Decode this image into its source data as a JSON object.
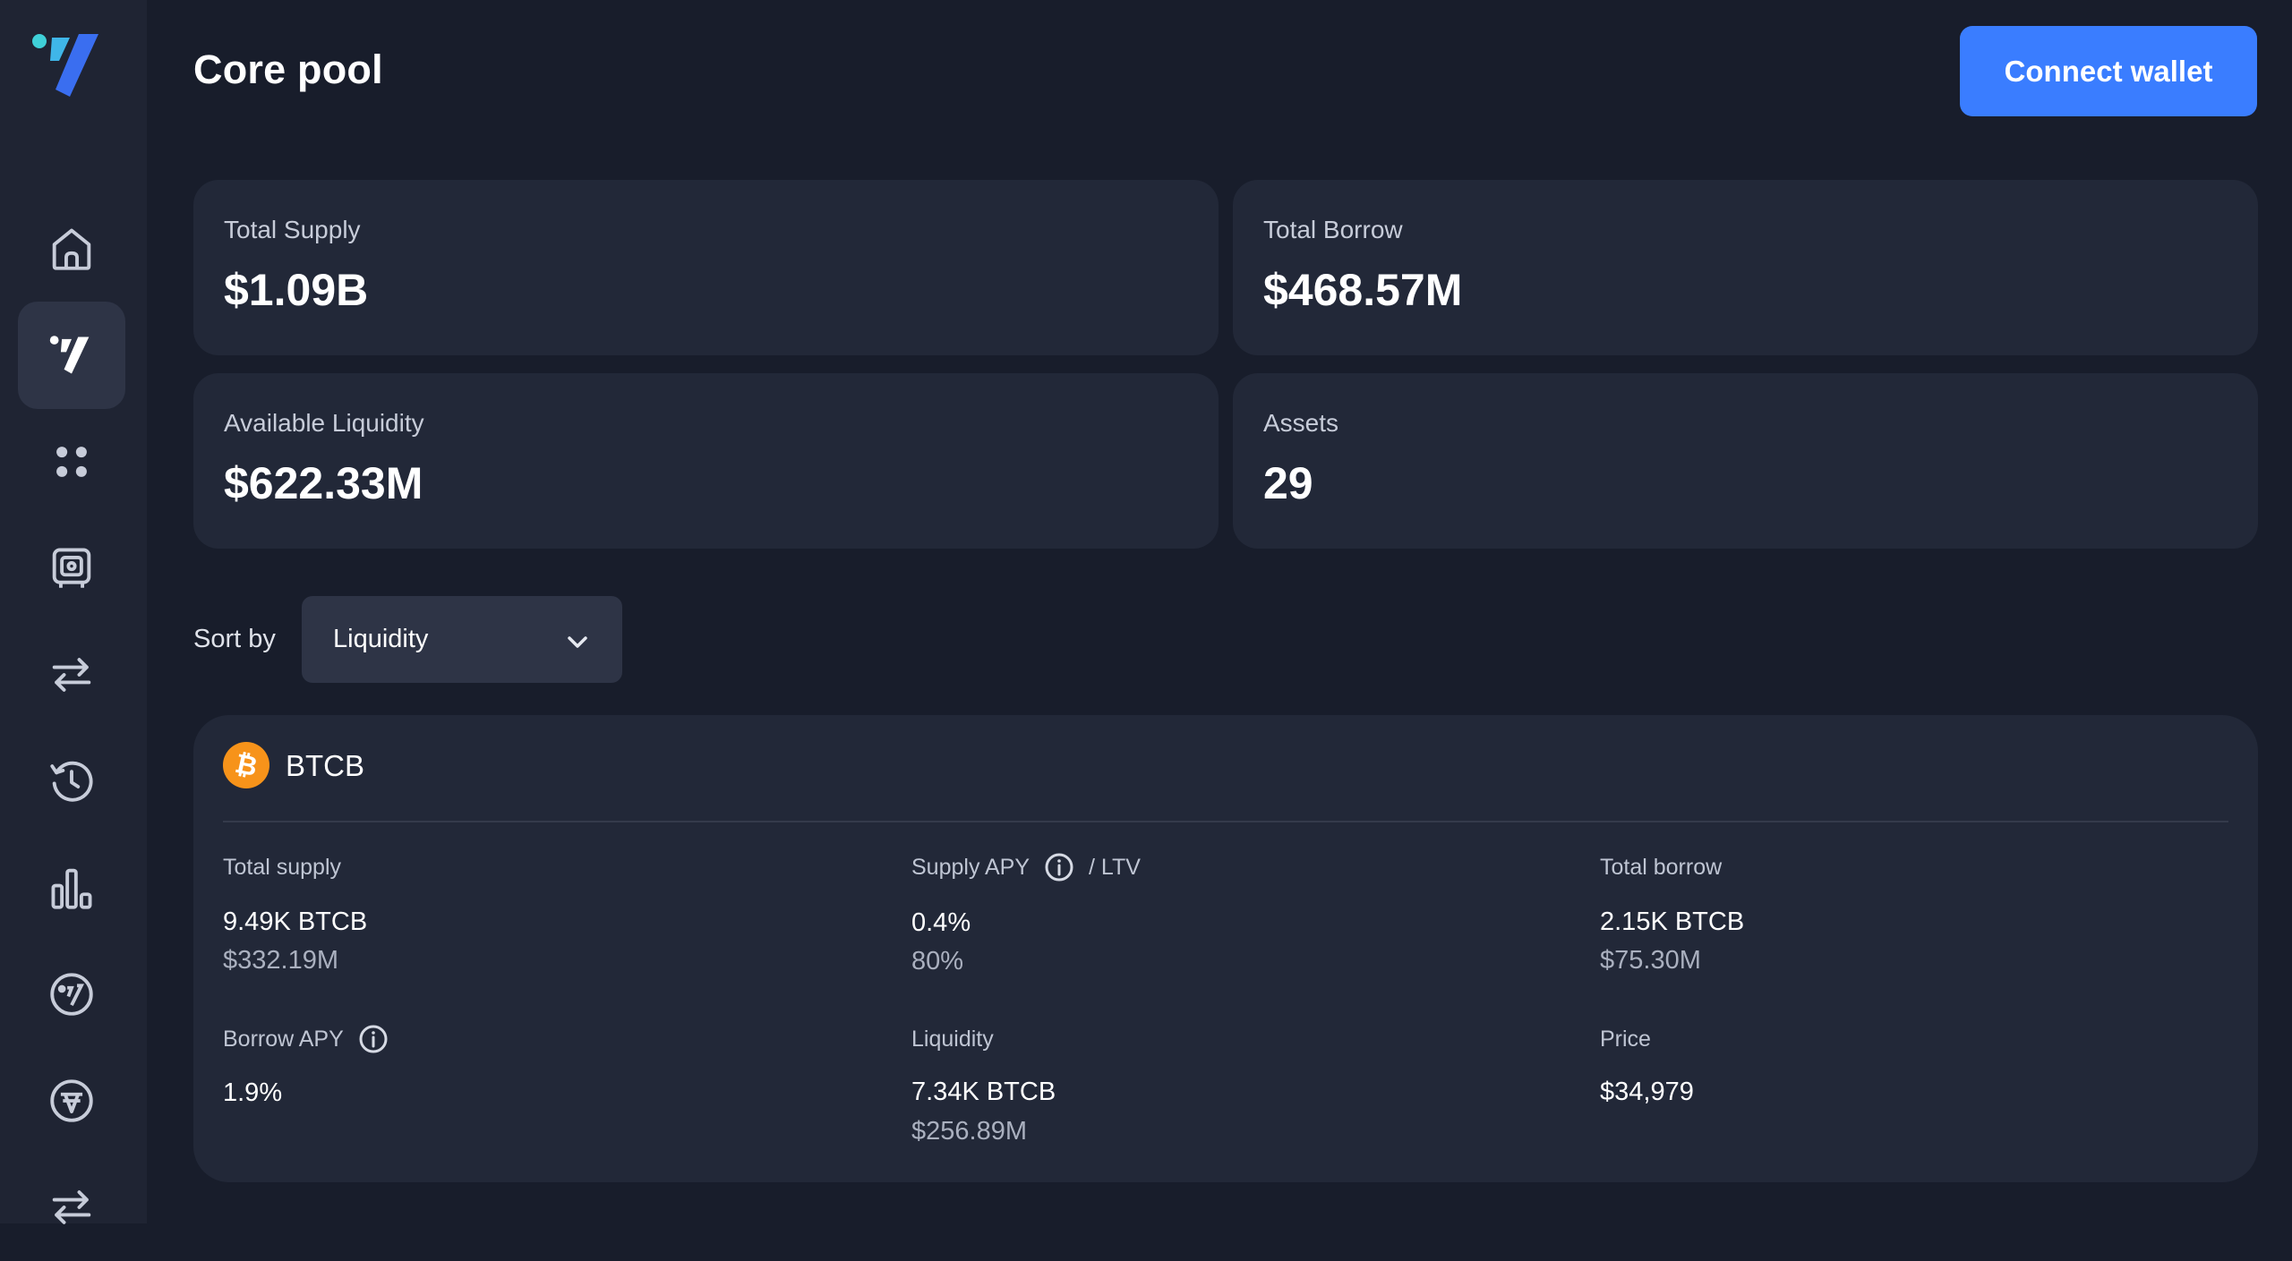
{
  "page": {
    "title": "Core pool"
  },
  "header": {
    "connect_wallet_label": "Connect wallet"
  },
  "sidebar": {
    "items": [
      {
        "icon": "home-icon"
      },
      {
        "icon": "venus-logo-icon",
        "active": true
      },
      {
        "icon": "dots-grid-icon"
      },
      {
        "icon": "vault-icon"
      },
      {
        "icon": "swap-arrows-icon"
      },
      {
        "icon": "history-clock-icon"
      },
      {
        "icon": "bar-chart-icon"
      },
      {
        "icon": "venus-badge-icon"
      },
      {
        "icon": "vai-icon"
      },
      {
        "icon": "swap-arrows-icon"
      }
    ]
  },
  "stats": {
    "total_supply": {
      "label": "Total Supply",
      "value": "$1.09B"
    },
    "total_borrow": {
      "label": "Total Borrow",
      "value": "$468.57M"
    },
    "available_liquidity": {
      "label": "Available Liquidity",
      "value": "$622.33M"
    },
    "assets": {
      "label": "Assets",
      "value": "29"
    }
  },
  "sort": {
    "label": "Sort by",
    "selected": "Liquidity"
  },
  "asset": {
    "name": "BTCB",
    "icon": "bitcoin-icon",
    "total_supply": {
      "label": "Total supply",
      "amount": "9.49K BTCB",
      "usd": "$332.19M"
    },
    "supply_apy": {
      "label": "Supply APY",
      "ltv_label": "/ LTV",
      "apy": "0.4%",
      "ltv": "80%"
    },
    "total_borrow": {
      "label": "Total borrow",
      "amount": "2.15K BTCB",
      "usd": "$75.30M"
    },
    "borrow_apy": {
      "label": "Borrow APY",
      "apy": "1.9%"
    },
    "liquidity": {
      "label": "Liquidity",
      "amount": "7.34K BTCB",
      "usd": "$256.89M"
    },
    "price": {
      "label": "Price",
      "value": "$34,979"
    }
  },
  "colors": {
    "background": "#181d2b",
    "sidebar": "#1f2433",
    "card": "#222838",
    "accent": "#3a7dff",
    "bitcoin": "#f7931a"
  }
}
